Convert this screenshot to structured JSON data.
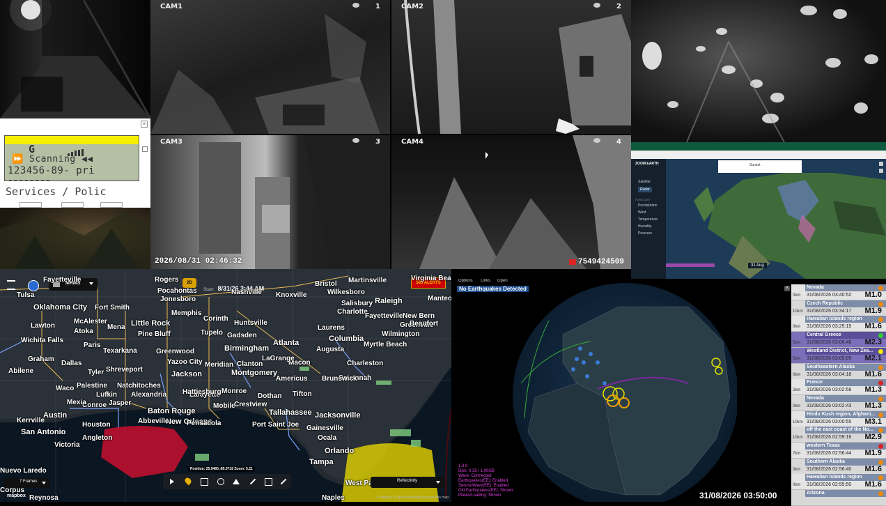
{
  "cameras": {
    "cam1": {
      "label": "CAM1",
      "num": "1"
    },
    "cam2": {
      "label": "CAM2",
      "num": "2"
    },
    "cam3": {
      "label": "CAM3",
      "num": "3"
    },
    "cam4": {
      "label": "CAM4",
      "num": "4"
    },
    "timestamp": "2026/08/31 02:46:32",
    "counter": "7549424509"
  },
  "scanner": {
    "line1": "G",
    "line2": "⏩ Scanning ◀◀",
    "line3": "123456-89- pri",
    "line4": "--------",
    "line5": "Services / Polic"
  },
  "weather_map": {
    "product": "MRMS",
    "badge": "2D",
    "scan_label": "Scan:",
    "scan_time": "8/31/26 3:44 AM",
    "alerts_badge": "585 ALERTS",
    "position": "Position: 25.9480,-85.0718  Zoom: 5.21",
    "frames": "7 Frames",
    "layer": "Reflectivity",
    "attribution_logo": "mapbox",
    "attribution": "© Mapbox © OpenStreetMap Improve this map",
    "cities": [
      "Tulsa",
      "Fayetteville",
      "Oklahoma City",
      "Fort Smith",
      "Lawton",
      "Wichita Falls",
      "Little Rock",
      "Memphis",
      "Jonesboro",
      "Nashville",
      "Knoxville",
      "Wilkesboro",
      "Martinsville",
      "Bristol",
      "Charlotte",
      "Raleigh",
      "Salisbury",
      "Greenville",
      "Fayetteville",
      "Wilmington",
      "Columbia",
      "Atlanta",
      "Birmingham",
      "Huntsville",
      "Tupelo",
      "Corinth",
      "Augusta",
      "Myrtle Beach",
      "Charleston",
      "Savannah",
      "Macon",
      "Montgomery",
      "Texarkana",
      "Shreveport",
      "Dallas",
      "Tyler",
      "Waco",
      "Abilene",
      "Austin",
      "San Antonio",
      "Houston",
      "Baton Rouge",
      "New Orleans",
      "Mobile",
      "Tallahassee",
      "Jacksonville",
      "Gainesville",
      "Orlando",
      "Tampa",
      "West Palm Beach",
      "Naples",
      "Nuevo Laredo",
      "Victoria",
      "Jackson",
      "Natchitoches",
      "Pine Bluff",
      "Greenwood",
      "Dothan",
      "Pensacola",
      "Ocala",
      "Brunswick",
      "Laurens",
      "Americus",
      "Gadsden",
      "Clanton",
      "Meridian",
      "Monroe",
      "Alexandria",
      "Lafayette",
      "Conroe",
      "Palestine",
      "Lufkin",
      "Jasper",
      "Abbeville",
      "Crestview",
      "Port Saint Joe",
      "Tifton",
      "Kerrville",
      "Reynosa",
      "Angleton",
      "Manteo",
      "Beaufort",
      "New Bern",
      "Virginia Beach",
      "Hattiesburg",
      "Yazoo City",
      "LaGrange",
      "Paris",
      "Atoka",
      "McAlester",
      "Graham",
      "Mena",
      "Rogers",
      "Pocahontas",
      "Mexia",
      "Corpus"
    ]
  },
  "earthquake": {
    "menu": [
      "Options",
      "Links",
      "Open"
    ],
    "status": "No Earthquakes Detected",
    "stats": [
      "1.3.9",
      "Disk: 0.35 / 1.00GB",
      "Wave: Connected",
      "Earthquakes(EE): Enabled",
      "SeismoWave(EE): Enabled",
      "Old Earthquakes(EE): Shown",
      "Plates/Loading: Shown"
    ],
    "clock": "31/08/2026 03:50:00",
    "list": [
      {
        "loc": "Nevada",
        "time": "31/08/2026 03:40:52",
        "mag": "M1.0",
        "dist": "0km",
        "color": "#f08a00",
        "highlight": false
      },
      {
        "loc": "Czech Republic",
        "time": "31/08/2026 03:34:17",
        "mag": "M1.9",
        "dist": "10km",
        "color": "#f08a00",
        "highlight": false
      },
      {
        "loc": "Hawaiian Islands region",
        "time": "31/08/2026 03:25:15",
        "mag": "M1.6",
        "dist": "0km",
        "color": "#f08a00",
        "highlight": false
      },
      {
        "loc": "Central Greece",
        "time": "31/08/2026 03:06:46",
        "mag": "M2.3",
        "dist": "5km",
        "color": "#33cc33",
        "highlight": true
      },
      {
        "loc": "Westland District, New Zea...",
        "time": "31/08/2026 03:05:05",
        "mag": "M2.1",
        "dist": "5km",
        "color": "#eeee00",
        "highlight": true
      },
      {
        "loc": "Southeastern Alaska",
        "time": "31/08/2026 03:04:18",
        "mag": "M1.6",
        "dist": "0km",
        "color": "#f08a00",
        "highlight": false
      },
      {
        "loc": "France",
        "time": "31/08/2026 03:02:58",
        "mag": "M1.3",
        "dist": "2km",
        "color": "#dd2222",
        "highlight": false
      },
      {
        "loc": "Nevada",
        "time": "31/08/2026 03:02:43",
        "mag": "M1.3",
        "dist": "0km",
        "color": "#f08a00",
        "highlight": false
      },
      {
        "loc": "Hindu Kush region, Afghani...",
        "time": "31/08/2026 03:00:55",
        "mag": "M3.1",
        "dist": "10km",
        "color": "#f08a00",
        "highlight": false
      },
      {
        "loc": "off the east coast of the No...",
        "time": "31/08/2026 02:59:16",
        "mag": "M2.9",
        "dist": "10km",
        "color": "#f08a00",
        "highlight": false
      },
      {
        "loc": "western Texas",
        "time": "31/08/2026 02:56:44",
        "mag": "M1.9",
        "dist": "7km",
        "color": "#dd2222",
        "highlight": false
      },
      {
        "loc": "Southern Alaska",
        "time": "31/08/2026 02:56:40",
        "mag": "M1.6",
        "dist": "0km",
        "color": "#f08a00",
        "highlight": false
      },
      {
        "loc": "Hawaiian Islands region",
        "time": "31/08/2026 02:55:50",
        "mag": "M1.6",
        "dist": "0km",
        "color": "#f08a00",
        "highlight": false
      },
      {
        "loc": "Arizona",
        "time": "",
        "mag": "",
        "dist": "",
        "color": "#f08a00",
        "highlight": false
      }
    ]
  },
  "zoom_earth": {
    "brand": "ZOOM EARTH",
    "layers": [
      "Satellite",
      "Radar"
    ],
    "forecast_label": "FORECAST",
    "forecast": [
      "Precipitation",
      "Wind",
      "Temperature",
      "Humidity",
      "Pressure"
    ],
    "date": "31 Aug",
    "popup": "Sunset"
  }
}
